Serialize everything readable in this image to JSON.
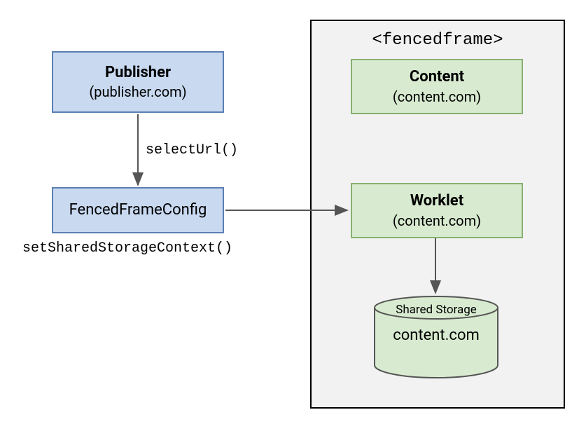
{
  "publisher": {
    "title": "Publisher",
    "subtitle": "(publisher.com)"
  },
  "fencedFrameConfig": {
    "label": "FencedFrameConfig"
  },
  "fencedFrame": {
    "tag": "<fencedframe>"
  },
  "content": {
    "title": "Content",
    "subtitle": "(content.com)"
  },
  "worklet": {
    "title": "Worklet",
    "subtitle": "(content.com)"
  },
  "sharedStorage": {
    "label": "Shared Storage",
    "domain": "content.com"
  },
  "calls": {
    "selectUrl": "selectUrl()",
    "setSharedStorageContext": "setSharedStorageContext()"
  }
}
